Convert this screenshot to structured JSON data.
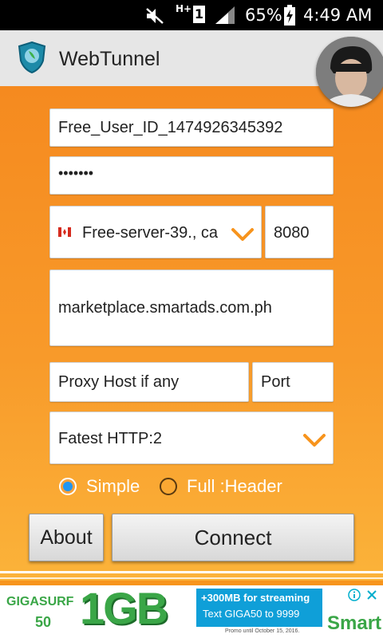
{
  "status_bar": {
    "battery_percent": "65%",
    "time": "4:49 AM",
    "network_label": "H+",
    "sim_number": "1"
  },
  "app_bar": {
    "title": "WebTunnel"
  },
  "form": {
    "user_id": "Free_User_ID_1474926345392",
    "password": "•••••••",
    "server": "Free-server-39., ca",
    "server_port": "8080",
    "host": "marketplace.smartads.com.ph",
    "proxy_host_placeholder": "Proxy Host if any",
    "proxy_port_placeholder": "Port",
    "method": "Fatest HTTP:2"
  },
  "modes": {
    "simple_label": "Simple",
    "full_label": "Full :Header",
    "selected": "simple"
  },
  "buttons": {
    "about_label": "About",
    "connect_label": "Connect"
  },
  "ad": {
    "brand_left_1": "GIGASURF",
    "brand_left_2": "50",
    "big": "1GB",
    "promo_line_1": "+300MB for streaming",
    "promo_line_2": "Text GIGA50 to 9999",
    "brand_right": "Smart",
    "fine_print": "Promo until October 15, 2016."
  },
  "colors": {
    "accent": "#f7941d",
    "radio_selected": "#2196f3",
    "chevron": "#f7941d"
  }
}
